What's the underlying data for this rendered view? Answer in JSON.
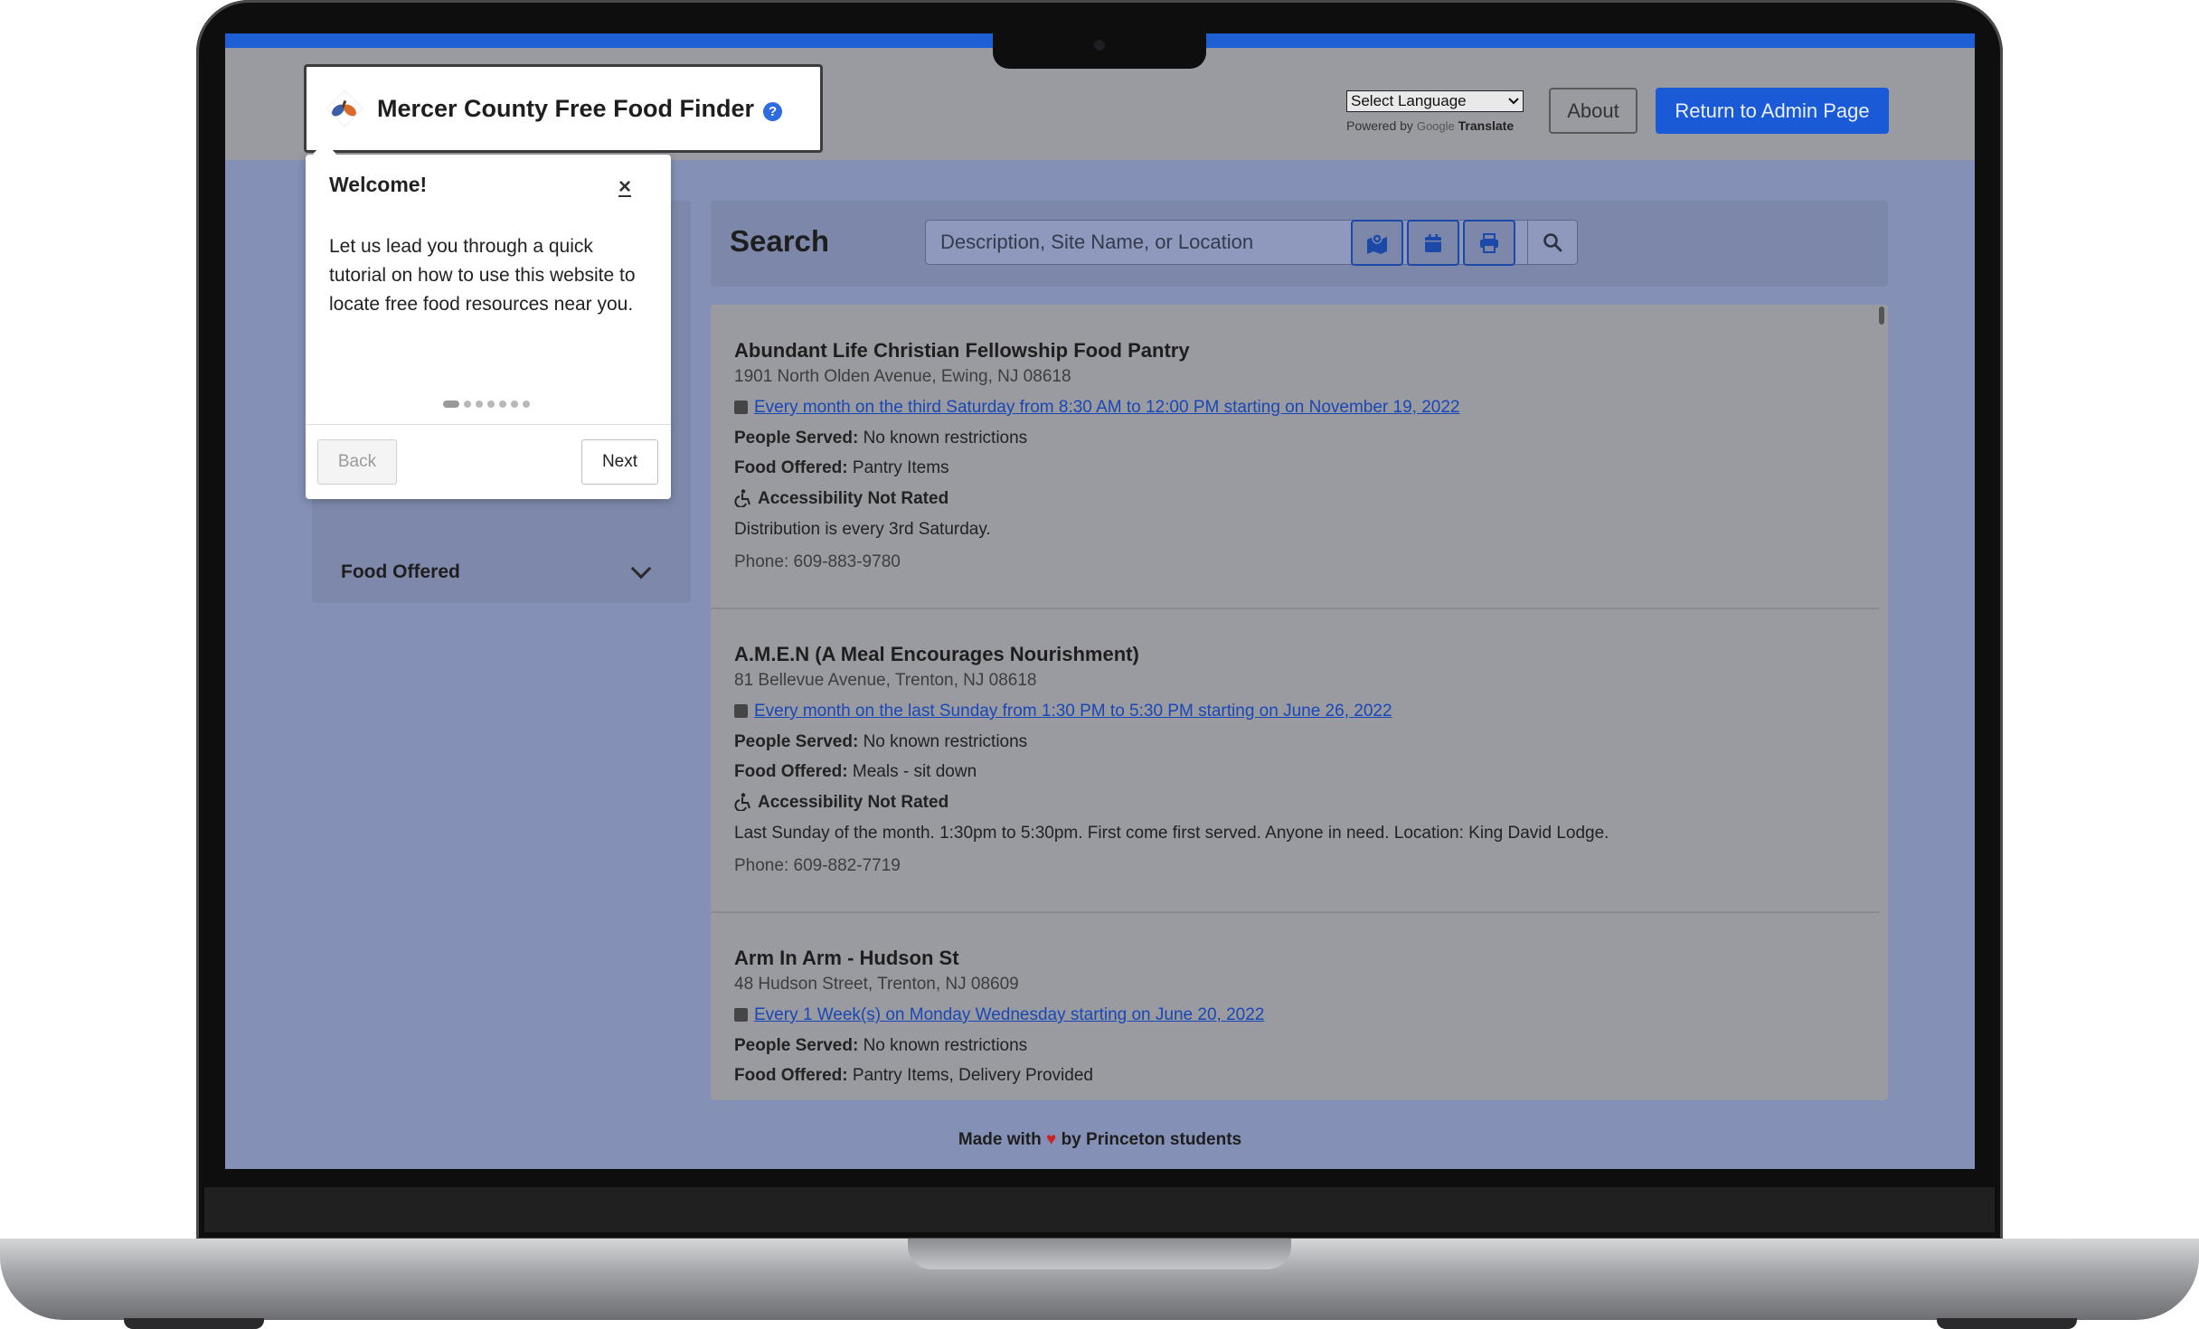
{
  "app": {
    "title": "Mercer County Free Food Finder",
    "help_glyph": "?"
  },
  "header": {
    "language_select": "Select Language",
    "powered_by": "Powered by",
    "google": "Google",
    "translate": "Translate",
    "about_label": "About",
    "admin_label": "Return to Admin Page"
  },
  "sidebar": {
    "filter_label": "Food Offered"
  },
  "search": {
    "title": "Search",
    "placeholder": "Description, Site Name, or Location",
    "tools": [
      "map-icon",
      "calendar-icon",
      "print-icon"
    ]
  },
  "results": [
    {
      "name": "Abundant Life Christian Fellowship Food Pantry",
      "address": "1901 North Olden Avenue, Ewing, NJ 08618",
      "schedule": "Every month on the third Saturday from 8:30 AM to 12:00 PM starting on November 19, 2022",
      "people_label": "People Served:",
      "people": "No known restrictions",
      "food_label": "Food Offered:",
      "food": "Pantry Items",
      "accessibility": "Accessibility Not Rated",
      "description": "Distribution is every 3rd Saturday.",
      "phone": "Phone: 609-883-9780"
    },
    {
      "name": "A.M.E.N (A Meal Encourages Nourishment)",
      "address": "81 Bellevue Avenue, Trenton, NJ 08618",
      "schedule": "Every month on the last Sunday from 1:30 PM to 5:30 PM starting on June 26, 2022",
      "people_label": "People Served:",
      "people": "No known restrictions",
      "food_label": "Food Offered:",
      "food": "Meals - sit down",
      "accessibility": "Accessibility Not Rated",
      "description": "Last Sunday of the month. 1:30pm to 5:30pm. First come first served. Anyone in need. Location: King David Lodge.",
      "phone": "Phone: 609-882-7719"
    },
    {
      "name": "Arm In Arm - Hudson St",
      "address": "48 Hudson Street, Trenton, NJ 08609",
      "schedule": "Every 1 Week(s) on Monday Wednesday starting on June 20, 2022",
      "people_label": "People Served:",
      "people": "No known restrictions",
      "food_label": "Food Offered:",
      "food": "Pantry Items, Delivery Provided"
    }
  ],
  "tutorial": {
    "title": "Welcome!",
    "close": "×",
    "body": "Let us lead you through a quick tutorial on how to use this website to locate free food resources near you.",
    "back_label": "Back",
    "next_label": "Next",
    "step": 1,
    "total_steps": 7
  },
  "footer": {
    "made_with": "Made with",
    "heart": "♥",
    "by": "by Princeton students"
  },
  "colors": {
    "accent": "#1a5ad7",
    "heart": "#c92323"
  }
}
